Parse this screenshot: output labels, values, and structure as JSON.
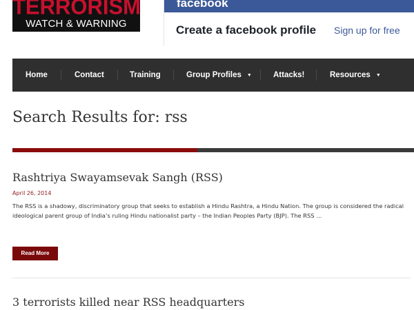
{
  "site": {
    "logo_top": "TERRORISM",
    "logo_bottom": "WATCH & WARNING"
  },
  "ad": {
    "brand": "facebook",
    "headline": "Create a facebook profile",
    "link": "Sign up for free"
  },
  "nav": {
    "items": [
      {
        "label": "Home",
        "has_dropdown": false
      },
      {
        "label": "Contact",
        "has_dropdown": false
      },
      {
        "label": "Training",
        "has_dropdown": false
      },
      {
        "label": "Group Profiles",
        "has_dropdown": true
      },
      {
        "label": "Attacks!",
        "has_dropdown": false
      },
      {
        "label": "Resources",
        "has_dropdown": true
      }
    ],
    "caret_glyph": "▼"
  },
  "page": {
    "title": "Search Results for: rss"
  },
  "results": [
    {
      "title": "Rashtriya Swayamsevak Sangh (RSS)",
      "date": "April 26, 2014",
      "excerpt": "The RSS is a shadowy, discriminatory group that seeks to establish a Hindu Rashtra, a Hindu Nation. The group is considered the radical ideological parent group of India’s ruling Hindu nationalist party – the Indian Peoples Party (BJP). The RSS …",
      "read_more": "Read More"
    },
    {
      "title": "3 terrorists killed near RSS headquarters"
    }
  ],
  "colors": {
    "brand_red": "#c8102e",
    "accent_dark_red": "#8b0b0b",
    "nav_bg": "#2f2f2f",
    "facebook_blue": "#3b5998"
  }
}
